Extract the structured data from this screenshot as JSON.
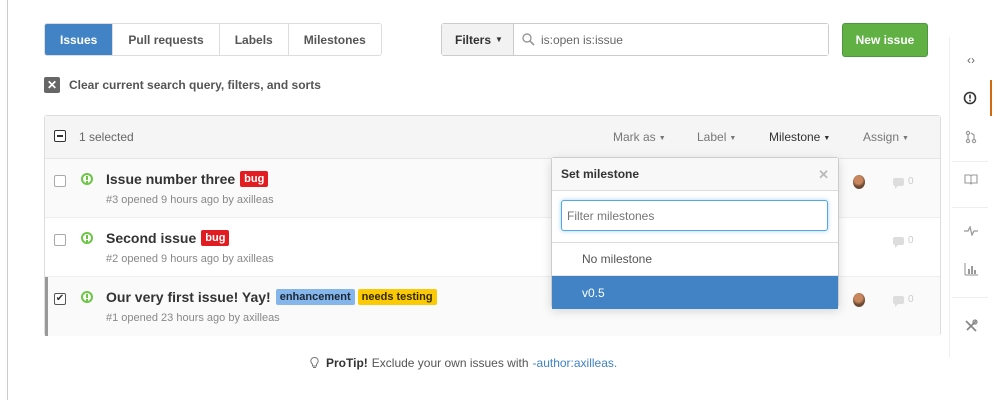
{
  "subnav": {
    "items": [
      {
        "label": "Issues",
        "selected": true
      },
      {
        "label": "Pull requests",
        "selected": false
      },
      {
        "label": "Labels",
        "selected": false
      },
      {
        "label": "Milestones",
        "selected": false
      }
    ]
  },
  "filters": {
    "button_label": "Filters",
    "search_value": "is:open is:issue"
  },
  "new_issue_label": "New issue",
  "clear_query_label": "Clear current search query, filters, and sorts",
  "table_header": {
    "selected_count": "1 selected",
    "menus": {
      "mark_as": "Mark as",
      "label": "Label",
      "milestone": "Milestone",
      "assign": "Assign"
    }
  },
  "issues": [
    {
      "title": "Issue number three",
      "labels": [
        "bug"
      ],
      "meta": "#3 opened 9 hours ago by axilleas",
      "comments": "0",
      "checked": false
    },
    {
      "title": "Second issue",
      "labels": [
        "bug"
      ],
      "meta": "#2 opened 9 hours ago by axilleas",
      "comments": "0",
      "checked": false
    },
    {
      "title": "Our very first issue! Yay!",
      "labels": [
        "enhancement",
        "needs testing"
      ],
      "meta": "#1 opened 23 hours ago by axilleas",
      "comments": "0",
      "checked": true
    }
  ],
  "milestone_popover": {
    "title": "Set milestone",
    "filter_placeholder": "Filter milestones",
    "options": [
      "No milestone",
      "v0.5"
    ],
    "selected": "v0.5"
  },
  "protip": {
    "prefix": "ProTip!",
    "text": "Exclude your own issues with",
    "link": "-author:axilleas."
  },
  "colors": {
    "accent_blue": "#4183c4",
    "green_button": "#60b044",
    "bug_label": "#e11d21",
    "enhancement_label": "#84b6eb",
    "needs_testing_label": "#fbca04",
    "rail_active": "#d26911"
  },
  "rail_icons": [
    "code-icon",
    "issue-opened-icon",
    "git-pull-request-icon",
    "book-icon",
    "pulse-icon",
    "graph-icon",
    "tools-icon"
  ]
}
